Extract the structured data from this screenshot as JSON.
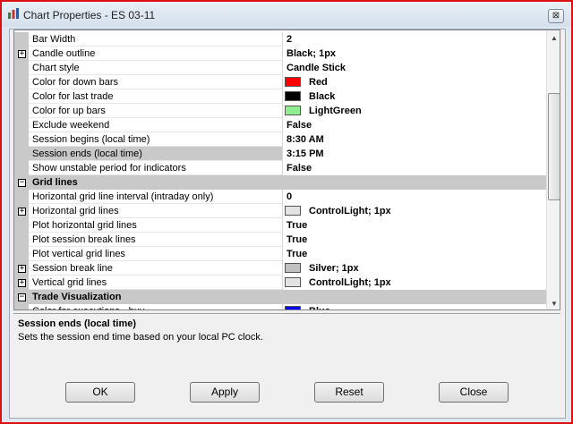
{
  "window": {
    "title": "Chart Properties - ES 03-11",
    "close_glyph": "⊠"
  },
  "properties": [
    {
      "name": "Bar Width",
      "value": "2"
    },
    {
      "name": "Candle outline",
      "value": "Black; 1px",
      "expander": "+"
    },
    {
      "name": "Chart style",
      "value": "Candle Stick"
    },
    {
      "name": "Color for down bars",
      "value": "Red",
      "swatch": "#ff0000"
    },
    {
      "name": "Color for last trade",
      "value": "Black",
      "swatch": "#000000"
    },
    {
      "name": "Color for up bars",
      "value": "LightGreen",
      "swatch": "#90ee90"
    },
    {
      "name": "Exclude weekend",
      "value": "False"
    },
    {
      "name": "Session begins (local time)",
      "value": "8:30 AM"
    },
    {
      "name": "Session ends (local time)",
      "value": "3:15 PM",
      "selected": true
    },
    {
      "name": "Show unstable period for indicators",
      "value": "False"
    },
    {
      "name": "Grid lines",
      "category": true,
      "expander": "−"
    },
    {
      "name": "Horizontal grid line interval (intraday only)",
      "value": "0"
    },
    {
      "name": "Horizontal grid lines",
      "value": "ControlLight; 1px",
      "swatch": "#e3e3e3",
      "expander": "+"
    },
    {
      "name": "Plot horizontal grid lines",
      "value": "True"
    },
    {
      "name": "Plot session break lines",
      "value": "True"
    },
    {
      "name": "Plot vertical grid lines",
      "value": "True"
    },
    {
      "name": "Session break line",
      "value": "Silver; 1px",
      "swatch": "#c0c0c0",
      "expander": "+"
    },
    {
      "name": "Vertical grid lines",
      "value": "ControlLight; 1px",
      "swatch": "#e3e3e3",
      "expander": "+"
    },
    {
      "name": "Trade Visualization",
      "category": true,
      "expander": "−"
    },
    {
      "name": "Color for executions - buy",
      "value": "Blue",
      "swatch": "#0000ff"
    }
  ],
  "help": {
    "title": "Session ends (local time)",
    "description": "Sets the session end time based on your local PC clock."
  },
  "buttons": {
    "ok": "OK",
    "apply": "Apply",
    "reset": "Reset",
    "close": "Close"
  },
  "icons": {
    "app": "chart-icon",
    "close": "close-icon",
    "scroll_up": "scroll-up-icon",
    "scroll_down": "scroll-down-icon"
  }
}
